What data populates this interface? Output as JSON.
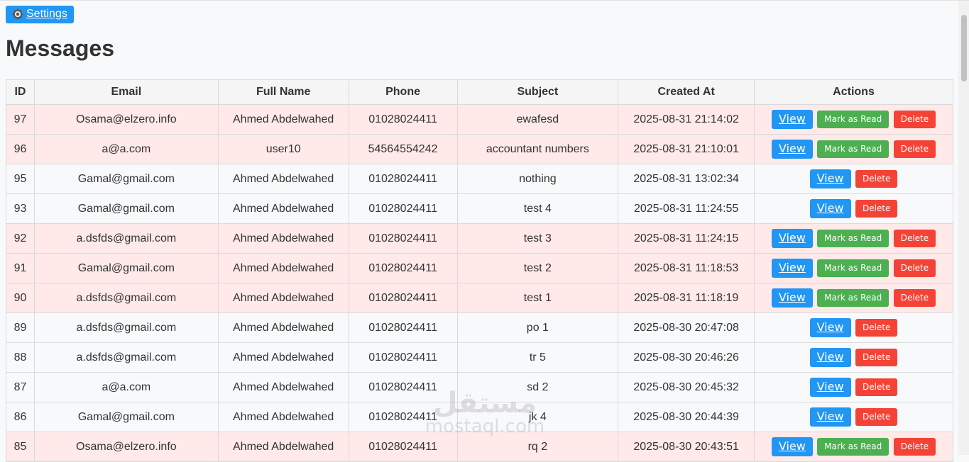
{
  "header": {
    "settings_label": "Settings",
    "page_title": "Messages"
  },
  "table": {
    "columns": [
      "ID",
      "Email",
      "Full Name",
      "Phone",
      "Subject",
      "Created At",
      "Actions"
    ],
    "actions": {
      "view": "View",
      "mark_read": "Mark as Read",
      "delete": "Delete"
    },
    "rows": [
      {
        "id": "97",
        "email": "Osama@elzero.info",
        "name": "Ahmed Abdelwahed",
        "phone": "01028024411",
        "subject": "ewafesd",
        "created": "2025-08-31 21:14:02",
        "unread": true
      },
      {
        "id": "96",
        "email": "a@a.com",
        "name": "user10",
        "phone": "54564554242",
        "subject": "accountant numbers",
        "created": "2025-08-31 21:10:01",
        "unread": true
      },
      {
        "id": "95",
        "email": "Gamal@gmail.com",
        "name": "Ahmed Abdelwahed",
        "phone": "01028024411",
        "subject": "nothing",
        "created": "2025-08-31 13:02:34",
        "unread": false
      },
      {
        "id": "93",
        "email": "Gamal@gmail.com",
        "name": "Ahmed Abdelwahed",
        "phone": "01028024411",
        "subject": "test 4",
        "created": "2025-08-31 11:24:55",
        "unread": false
      },
      {
        "id": "92",
        "email": "a.dsfds@gmail.com",
        "name": "Ahmed Abdelwahed",
        "phone": "01028024411",
        "subject": "test 3",
        "created": "2025-08-31 11:24:15",
        "unread": true
      },
      {
        "id": "91",
        "email": "Gamal@gmail.com",
        "name": "Ahmed Abdelwahed",
        "phone": "01028024411",
        "subject": "test 2",
        "created": "2025-08-31 11:18:53",
        "unread": true
      },
      {
        "id": "90",
        "email": "a.dsfds@gmail.com",
        "name": "Ahmed Abdelwahed",
        "phone": "01028024411",
        "subject": "test 1",
        "created": "2025-08-31 11:18:19",
        "unread": true
      },
      {
        "id": "89",
        "email": "a.dsfds@gmail.com",
        "name": "Ahmed Abdelwahed",
        "phone": "01028024411",
        "subject": "po 1",
        "created": "2025-08-30 20:47:08",
        "unread": false
      },
      {
        "id": "88",
        "email": "a.dsfds@gmail.com",
        "name": "Ahmed Abdelwahed",
        "phone": "01028024411",
        "subject": "tr 5",
        "created": "2025-08-30 20:46:26",
        "unread": false
      },
      {
        "id": "87",
        "email": "a@a.com",
        "name": "Ahmed Abdelwahed",
        "phone": "01028024411",
        "subject": "sd 2",
        "created": "2025-08-30 20:45:32",
        "unread": false
      },
      {
        "id": "86",
        "email": "Gamal@gmail.com",
        "name": "Ahmed Abdelwahed",
        "phone": "01028024411",
        "subject": "jk 4",
        "created": "2025-08-30 20:44:39",
        "unread": false
      },
      {
        "id": "85",
        "email": "Osama@elzero.info",
        "name": "Ahmed Abdelwahed",
        "phone": "01028024411",
        "subject": "rq 2",
        "created": "2025-08-30 20:43:51",
        "unread": true
      }
    ]
  },
  "watermark": {
    "arabic": "مستقل",
    "latin": "mostaql.com"
  },
  "colors": {
    "view": "#2196f3",
    "mark_read": "#4caf50",
    "delete": "#f44336",
    "unread_row": "#ffe9e9"
  },
  "icons": {
    "settings": "gear-icon"
  }
}
